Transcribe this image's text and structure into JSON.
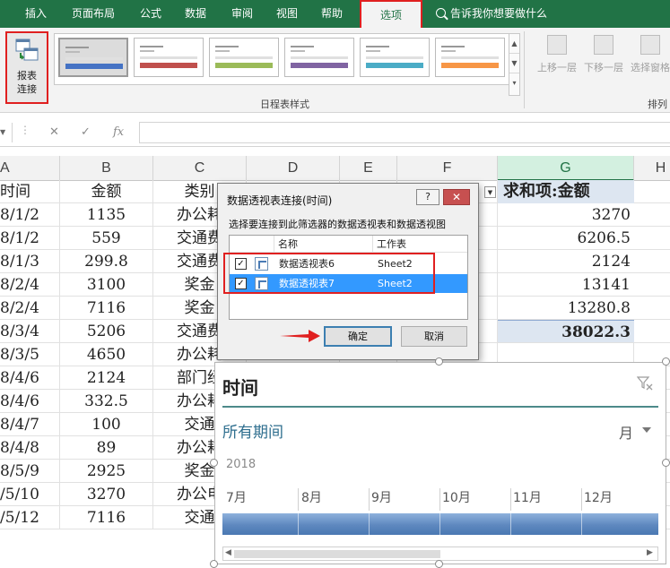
{
  "ribbon_tabs": [
    "插入",
    "页面布局",
    "公式",
    "数据",
    "审阅",
    "视图",
    "帮助",
    "选项"
  ],
  "tell_me": "告诉我你想要做什么",
  "report_connections": {
    "line1": "报表",
    "line2": "连接"
  },
  "styles_group_label": "日程表样式",
  "arrange_items": [
    "上移一层",
    "下移一层",
    "选择窗格"
  ],
  "arrange_group_label": "排列",
  "swatch_colors": [
    "#4472c4",
    "#c0504d",
    "#9bbb59",
    "#8064a2",
    "#4bacc6",
    "#f79646"
  ],
  "formula_bar": {
    "cancel": "✕",
    "enter": "✓",
    "fx": "fx"
  },
  "columns": [
    "A",
    "B",
    "C",
    "D",
    "E",
    "F",
    "G",
    "H"
  ],
  "grid": {
    "header": {
      "a": "时间",
      "b": "金额",
      "c": "类别"
    },
    "rows": [
      {
        "a": "8/1/2",
        "b": "1135",
        "c": "办公耗"
      },
      {
        "a": "8/1/2",
        "b": "559",
        "c": "交通费"
      },
      {
        "a": "8/1/3",
        "b": "299.8",
        "c": "交通费"
      },
      {
        "a": "8/2/4",
        "b": "3100",
        "c": "奖金"
      },
      {
        "a": "8/2/4",
        "b": "7116",
        "c": "奖金"
      },
      {
        "a": "8/3/4",
        "b": "5206",
        "c": "交通费"
      },
      {
        "a": "8/3/5",
        "b": "4650",
        "c": "办公耗"
      },
      {
        "a": "8/4/6",
        "b": "2124",
        "c": "部门经"
      },
      {
        "a": "8/4/6",
        "b": "332.5",
        "c": "办公耗"
      },
      {
        "a": "8/4/7",
        "b": "100",
        "c": "交通"
      },
      {
        "a": "8/4/8",
        "b": "89",
        "c": "办公耗"
      },
      {
        "a": "8/5/9",
        "b": "2925",
        "c": "奖金"
      },
      {
        "a": "/5/10",
        "b": "3270",
        "c": "办公电"
      },
      {
        "a": "/5/12",
        "b": "7116",
        "c": "交通"
      }
    ]
  },
  "pivot": {
    "header": "求和项:金额",
    "values": [
      "3270",
      "6206.5",
      "2124",
      "13141",
      "13280.8"
    ],
    "total": "38022.3"
  },
  "dialog": {
    "title": "数据透视表连接(时间)",
    "help": "?",
    "close": "✕",
    "instruction": "选择要连接到此筛选器的数据透视表和数据透视图",
    "col_name": "名称",
    "col_sheet": "工作表",
    "items": [
      {
        "name": "数据透视表6",
        "sheet": "Sheet2",
        "checked": "✓"
      },
      {
        "name": "数据透视表7",
        "sheet": "Sheet2",
        "checked": "✓"
      }
    ],
    "ok": "确定",
    "cancel": "取消"
  },
  "timeline": {
    "title": "时间",
    "period": "所有期间",
    "level": "月",
    "year": "2018",
    "months": [
      "7月",
      "8月",
      "9月",
      "10月",
      "11月",
      "12月"
    ]
  }
}
